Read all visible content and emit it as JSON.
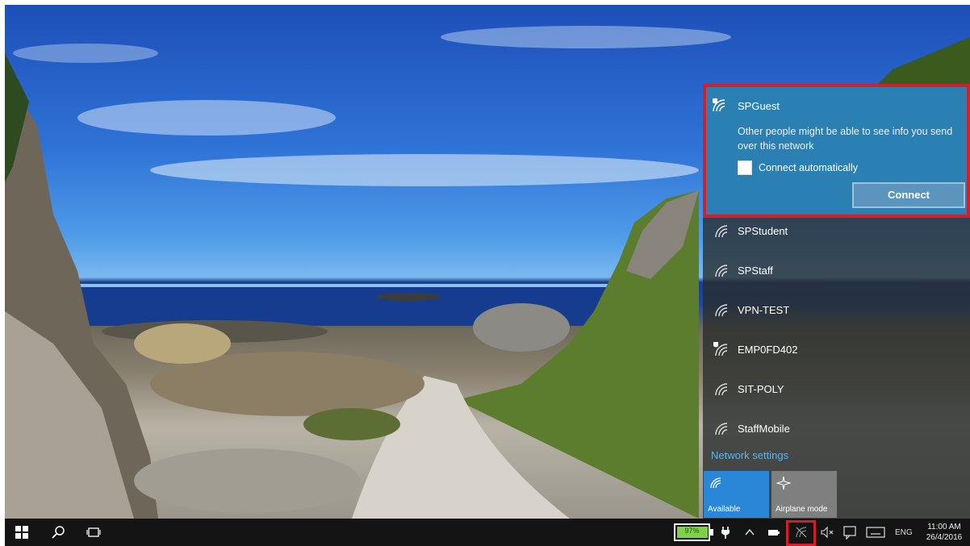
{
  "network_flyout": {
    "selected_network": {
      "name": "SPGuest",
      "icon": "wifi-secured-warning-icon",
      "warning": "Other people might be able to see info you send over this network",
      "connect_automatically_label": "Connect automatically",
      "connect_automatically_checked": false,
      "connect_button_label": "Connect"
    },
    "networks": [
      {
        "name": "SPStudent",
        "icon": "wifi-icon"
      },
      {
        "name": "SPStaff",
        "icon": "wifi-icon"
      },
      {
        "name": "VPN-TEST",
        "icon": "wifi-icon"
      },
      {
        "name": "EMP0FD402",
        "icon": "wifi-secured-warning-icon"
      },
      {
        "name": "SIT-POLY",
        "icon": "wifi-icon"
      },
      {
        "name": "StaffMobile",
        "icon": "wifi-icon"
      }
    ],
    "network_settings_label": "Network settings",
    "quick_actions": [
      {
        "label": "Available",
        "icon": "wifi-icon",
        "active": true
      },
      {
        "label": "Airplane mode",
        "icon": "airplane-icon",
        "active": false
      }
    ]
  },
  "taskbar": {
    "battery_percent": "97%",
    "language": "ENG",
    "time": "11:00 AM",
    "date": "26/4/2016"
  },
  "colors": {
    "accent": "#2a86d6",
    "selected_network_bg": "#2a7fb3",
    "highlight_border": "#d31f2b"
  }
}
